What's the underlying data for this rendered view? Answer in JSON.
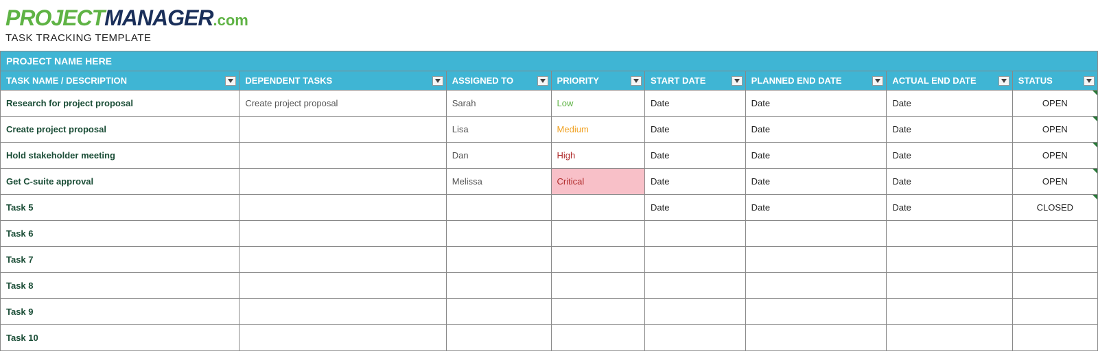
{
  "logo": {
    "part1": "PROJECT",
    "part2": "MANAGER",
    "part3": ".com"
  },
  "subtitle": "TASK TRACKING TEMPLATE",
  "project_name": "PROJECT NAME HERE",
  "columns": {
    "task_name": "TASK NAME / DESCRIPTION",
    "dependent_tasks": "DEPENDENT TASKS",
    "assigned_to": "ASSIGNED TO",
    "priority": "PRIORITY",
    "start_date": "START DATE",
    "planned_end_date": "PLANNED END DATE",
    "actual_end_date": "ACTUAL END DATE",
    "status": "STATUS"
  },
  "priority_colors": {
    "Low": "#5fb345",
    "Medium": "#f0a020",
    "High": "#b02a2a",
    "Critical": "#b02a2a",
    "Critical_bg": "#f8c0c8"
  },
  "rows": [
    {
      "task_name": "Research for project proposal",
      "dependent_tasks": "Create project proposal",
      "assigned_to": "Sarah",
      "priority": "Low",
      "start_date": "Date",
      "planned_end_date": "Date",
      "actual_end_date": "Date",
      "status": "OPEN",
      "status_tick": true
    },
    {
      "task_name": "Create project proposal",
      "dependent_tasks": "",
      "assigned_to": "Lisa",
      "priority": "Medium",
      "start_date": "Date",
      "planned_end_date": "Date",
      "actual_end_date": "Date",
      "status": "OPEN",
      "status_tick": true
    },
    {
      "task_name": "Hold stakeholder meeting",
      "dependent_tasks": "",
      "assigned_to": "Dan",
      "priority": "High",
      "start_date": "Date",
      "planned_end_date": "Date",
      "actual_end_date": "Date",
      "status": "OPEN",
      "status_tick": true
    },
    {
      "task_name": "Get C-suite approval",
      "dependent_tasks": "",
      "assigned_to": "Melissa",
      "priority": "Critical",
      "start_date": "Date",
      "planned_end_date": "Date",
      "actual_end_date": "Date",
      "status": "OPEN",
      "status_tick": true
    },
    {
      "task_name": "Task 5",
      "dependent_tasks": "",
      "assigned_to": "",
      "priority": "",
      "start_date": "Date",
      "planned_end_date": "Date",
      "actual_end_date": "Date",
      "status": "CLOSED",
      "status_tick": true
    },
    {
      "task_name": "Task 6",
      "dependent_tasks": "",
      "assigned_to": "",
      "priority": "",
      "start_date": "",
      "planned_end_date": "",
      "actual_end_date": "",
      "status": "",
      "status_tick": false
    },
    {
      "task_name": "Task 7",
      "dependent_tasks": "",
      "assigned_to": "",
      "priority": "",
      "start_date": "",
      "planned_end_date": "",
      "actual_end_date": "",
      "status": "",
      "status_tick": false
    },
    {
      "task_name": "Task 8",
      "dependent_tasks": "",
      "assigned_to": "",
      "priority": "",
      "start_date": "",
      "planned_end_date": "",
      "actual_end_date": "",
      "status": "",
      "status_tick": false
    },
    {
      "task_name": "Task 9",
      "dependent_tasks": "",
      "assigned_to": "",
      "priority": "",
      "start_date": "",
      "planned_end_date": "",
      "actual_end_date": "",
      "status": "",
      "status_tick": false
    },
    {
      "task_name": "Task 10",
      "dependent_tasks": "",
      "assigned_to": "",
      "priority": "",
      "start_date": "",
      "planned_end_date": "",
      "actual_end_date": "",
      "status": "",
      "status_tick": false
    }
  ]
}
